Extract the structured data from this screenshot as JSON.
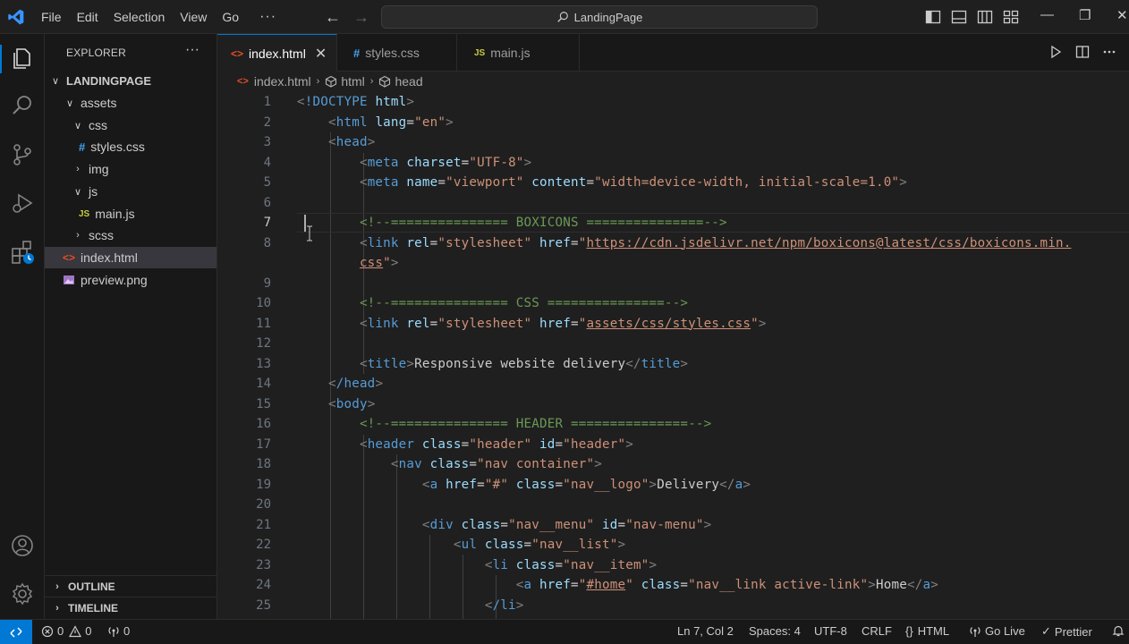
{
  "titlebar": {
    "menu": [
      "File",
      "Edit",
      "Selection",
      "View",
      "Go"
    ],
    "more": "···",
    "search": "LandingPage"
  },
  "activity_bar": [
    "explorer-icon",
    "search-icon",
    "source-control-icon",
    "run-debug-icon",
    "extensions-icon",
    "account-icon",
    "settings-icon"
  ],
  "sidebar": {
    "header": "EXPLORER",
    "more": "···",
    "tree": [
      {
        "label": "LANDINGPAGE",
        "type": "root"
      },
      {
        "label": "assets",
        "type": "folder-open"
      },
      {
        "label": "css",
        "type": "folder-open"
      },
      {
        "label": "styles.css",
        "type": "css",
        "icon": "#"
      },
      {
        "label": "img",
        "type": "folder-closed"
      },
      {
        "label": "js",
        "type": "folder-open"
      },
      {
        "label": "main.js",
        "type": "js",
        "icon": "JS"
      },
      {
        "label": "scss",
        "type": "folder-closed"
      },
      {
        "label": "index.html",
        "type": "html",
        "icon": "<>",
        "selected": true
      },
      {
        "label": "preview.png",
        "type": "image"
      }
    ],
    "sections": [
      "OUTLINE",
      "TIMELINE"
    ]
  },
  "tabs": [
    {
      "label": "index.html",
      "icon": "<>",
      "active": true,
      "close": "✕"
    },
    {
      "label": "styles.css",
      "icon": "#",
      "active": false
    },
    {
      "label": "main.js",
      "icon": "JS",
      "active": false
    }
  ],
  "breadcrumb": [
    "index.html",
    "html",
    "head"
  ],
  "editor": {
    "current_line": 7,
    "lines": [
      {
        "n": "1"
      },
      {
        "n": "2"
      },
      {
        "n": "3"
      },
      {
        "n": "4"
      },
      {
        "n": "5"
      },
      {
        "n": "6"
      },
      {
        "n": "7"
      },
      {
        "n": "8"
      },
      {
        "n": ""
      },
      {
        "n": "9"
      },
      {
        "n": "10"
      },
      {
        "n": "11"
      },
      {
        "n": "12"
      },
      {
        "n": "13"
      },
      {
        "n": "14"
      },
      {
        "n": "15"
      },
      {
        "n": "16"
      },
      {
        "n": "17"
      },
      {
        "n": "18"
      },
      {
        "n": "19"
      },
      {
        "n": "20"
      },
      {
        "n": "21"
      },
      {
        "n": "22"
      },
      {
        "n": "23"
      },
      {
        "n": "24"
      },
      {
        "n": "25"
      }
    ],
    "code": {
      "l1_doctype": "!DOCTYPE",
      "l1_html": "html",
      "l2_tag": "html",
      "l2_attr": "lang",
      "l2_val": "\"en\"",
      "l3_tag": "head",
      "l4_tag": "meta",
      "l4_attr": "charset",
      "l4_val": "\"UTF-8\"",
      "l5_tag": "meta",
      "l5_attr1": "name",
      "l5_val1": "\"viewport\"",
      "l5_attr2": "content",
      "l5_val2": "\"width=device-width, initial-scale=1.0\"",
      "l7_comment": "<!--=============== BOXICONS ===============-->",
      "l8_tag": "link",
      "l8_attr1": "rel",
      "l8_val1": "\"stylesheet\"",
      "l8_attr2": "href",
      "l8_val2_q": "\"",
      "l8_url1": "https://cdn.jsdelivr.net/npm/boxicons@latest/css/boxicons.min.",
      "l8_url2": "css",
      "l8_end_q": "\"",
      "l10_comment": "<!--=============== CSS ===============-->",
      "l11_tag": "link",
      "l11_attr1": "rel",
      "l11_val1": "\"stylesheet\"",
      "l11_attr2": "href",
      "l11_url": "assets/css/styles.css",
      "l13_tag": "title",
      "l13_text": "Responsive website delivery",
      "l14_tag": "/head",
      "l15_tag": "body",
      "l16_comment": "<!--=============== HEADER ===============-->",
      "l17_tag": "header",
      "l17_attr1": "class",
      "l17_val1": "\"header\"",
      "l17_attr2": "id",
      "l17_val2": "\"header\"",
      "l18_tag": "nav",
      "l18_attr": "class",
      "l18_val": "\"nav container\"",
      "l19_tag": "a",
      "l19_attr1": "href",
      "l19_val1": "\"#\"",
      "l19_attr2": "class",
      "l19_val2": "\"nav__logo\"",
      "l19_text": "Delivery",
      "l21_tag": "div",
      "l21_attr1": "class",
      "l21_val1": "\"nav__menu\"",
      "l21_attr2": "id",
      "l21_val2": "\"nav-menu\"",
      "l22_tag": "ul",
      "l22_attr": "class",
      "l22_val": "\"nav__list\"",
      "l23_tag": "li",
      "l23_attr": "class",
      "l23_val": "\"nav__item\"",
      "l24_tag": "a",
      "l24_attr1": "href",
      "l24_link": "#home",
      "l24_attr2": "class",
      "l24_val2": "\"nav__link active-link\"",
      "l24_text": "Home",
      "l25_tag": "/li"
    }
  },
  "statusbar": {
    "errors": "0",
    "warnings": "0",
    "ports": "0",
    "position": "Ln 7, Col 2",
    "spaces": "Spaces: 4",
    "encoding": "UTF-8",
    "eol": "CRLF",
    "language": "HTML",
    "golive": "Go Live",
    "prettier": "Prettier"
  },
  "colors": {
    "accent": "#0078d4",
    "tag": "#569cd6",
    "attribute": "#9cdcfe",
    "string": "#ce9178",
    "comment": "#6a9955",
    "html_icon": "#e44d26",
    "js_icon": "#cbcb41",
    "css_icon": "#42a5f5"
  }
}
